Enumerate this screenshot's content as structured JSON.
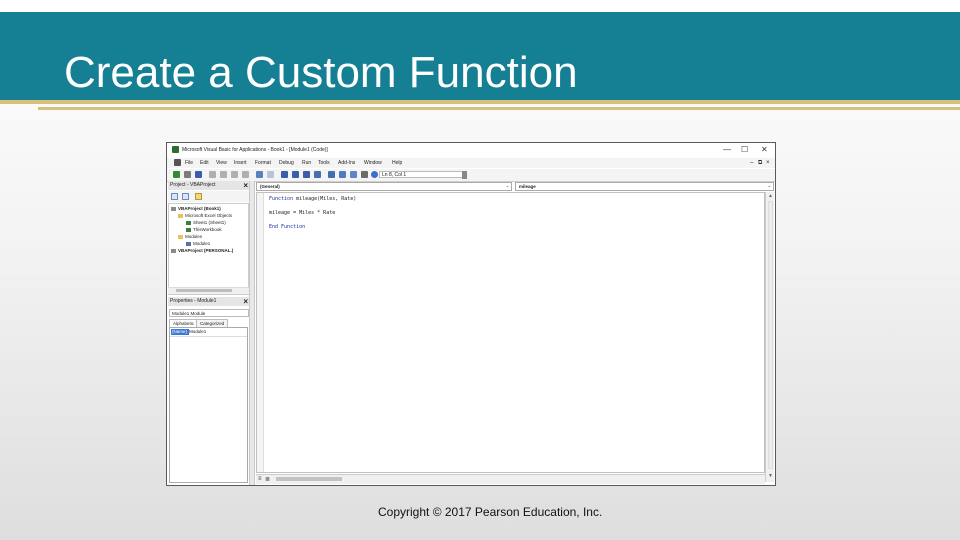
{
  "slide": {
    "title": "Create a Custom Function",
    "copyright": "Copyright © 2017 Pearson Education, Inc.",
    "colors": {
      "header": "#157f93",
      "accent_line": "#d8c07a",
      "code_keyword": "#1a2aa8"
    }
  },
  "vba": {
    "window_title": "Microsoft Visual Basic for Applications - Book1 - [Module1 (Code)]",
    "window_controls": {
      "minimize": "—",
      "restore": "☐",
      "close": "✕"
    },
    "menu": [
      "File",
      "Edit",
      "View",
      "Insert",
      "Format",
      "Debug",
      "Run",
      "Tools",
      "Add-Ins",
      "Window",
      "Help"
    ],
    "cursor_position": "Ln 8, Col 1",
    "project_pane": {
      "title": "Project - VBAProject",
      "tree": [
        "VBAProject (Book1)",
        "Microsoft Excel Objects",
        "Sheet1 (Sheet1)",
        "ThisWorkbook",
        "Modules",
        "Module1",
        "VBAProject (PERSONAL.)"
      ]
    },
    "properties_pane": {
      "title": "Properties - Module1",
      "object_select": "Module1 Module",
      "tabs": [
        "Alphabetic",
        "Categorized"
      ],
      "property_name": "(Name)",
      "property_value": "Module1"
    },
    "code_pane": {
      "object_dropdown": "(General)",
      "procedure_dropdown": "mileage",
      "lines": [
        {
          "kw": "Function",
          "rest": " mileage(Miles, Rate)"
        },
        {
          "kw": "",
          "rest": "mileage = Miles * Rate"
        },
        {
          "kw": "End Function",
          "rest": ""
        }
      ]
    }
  }
}
